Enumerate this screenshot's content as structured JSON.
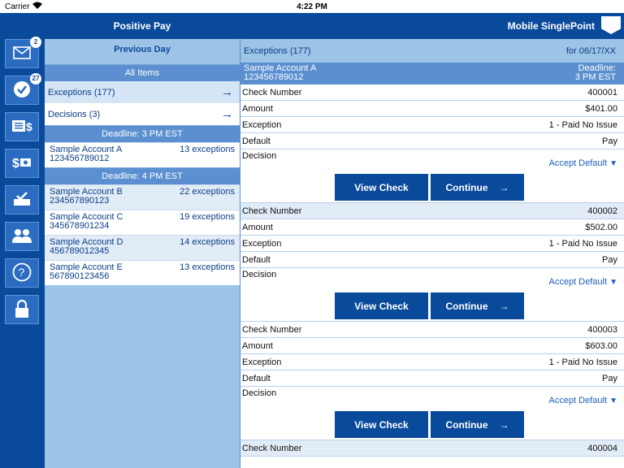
{
  "status": {
    "carrier": "Carrier",
    "time": "4:22 PM"
  },
  "header": {
    "title": "Positive Pay",
    "brand": "Mobile SinglePoint"
  },
  "rail": {
    "items": [
      {
        "icon": "mail-icon",
        "badge": "2"
      },
      {
        "icon": "checkmark-icon",
        "badge": "27"
      },
      {
        "icon": "bills-icon"
      },
      {
        "icon": "cash-icon"
      },
      {
        "icon": "deposit-icon"
      },
      {
        "icon": "users-icon"
      },
      {
        "icon": "help-icon"
      },
      {
        "icon": "lock-icon"
      }
    ]
  },
  "mid": {
    "header": "Previous Day",
    "all_items": "All Items",
    "nav": [
      {
        "label": "Exceptions (177)"
      },
      {
        "label": "Decisions (3)"
      }
    ],
    "groups": [
      {
        "deadline": "Deadline: 3 PM EST",
        "accounts": [
          {
            "name": "Sample Account A",
            "number": "123456789012",
            "count": "13 exceptions"
          }
        ]
      },
      {
        "deadline": "Deadline: 4 PM EST",
        "accounts": [
          {
            "name": "Sample Account B",
            "number": "234567890123",
            "count": "22 exceptions"
          },
          {
            "name": "Sample Account C",
            "number": "345678901234",
            "count": "19 exceptions"
          },
          {
            "name": "Sample Account D",
            "number": "456789012345",
            "count": "14 exceptions"
          },
          {
            "name": "Sample Account E",
            "number": "567890123456",
            "count": "13 exceptions"
          }
        ]
      }
    ]
  },
  "detail": {
    "title": "Exceptions (177)",
    "date": "for 06/17/XX",
    "account": {
      "name": "Sample Account A",
      "number": "123456789012",
      "deadline_label": "Deadline:",
      "deadline": "3 PM EST"
    },
    "labels": {
      "check": "Check Number",
      "amount": "Amount",
      "exception": "Exception",
      "default": "Default",
      "decision": "Decision"
    },
    "buttons": {
      "view": "View Check",
      "continue": "Continue"
    },
    "checks": [
      {
        "check": "400001",
        "amount": "$401.00",
        "exception": "1 - Paid No Issue",
        "default": "Pay",
        "decision": "Accept Default"
      },
      {
        "check": "400002",
        "amount": "$502.00",
        "exception": "1 - Paid No Issue",
        "default": "Pay",
        "decision": "Accept Default"
      },
      {
        "check": "400003",
        "amount": "$603.00",
        "exception": "1 - Paid No Issue",
        "default": "Pay",
        "decision": "Accept Default"
      },
      {
        "check": "400004"
      }
    ]
  }
}
